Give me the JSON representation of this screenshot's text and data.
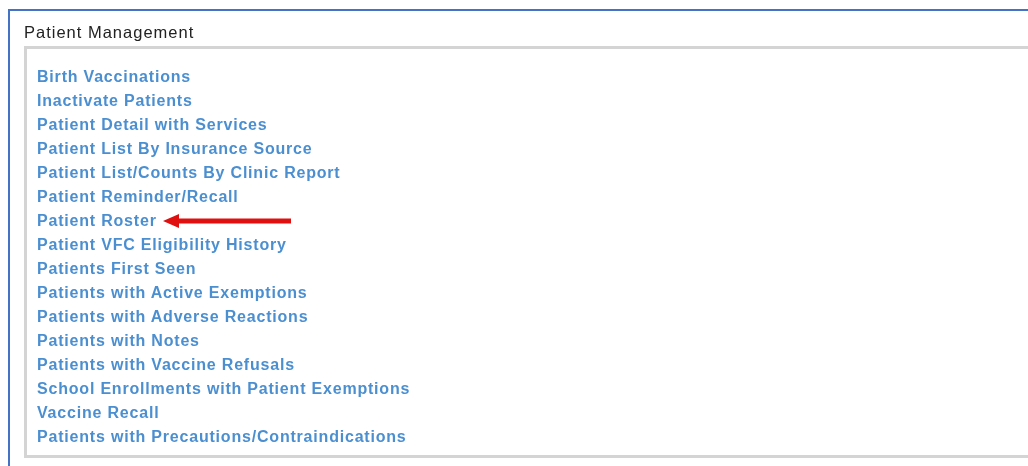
{
  "panel": {
    "title": "Patient Management"
  },
  "links": [
    {
      "label": "Birth Vaccinations",
      "marked": false
    },
    {
      "label": "Inactivate Patients",
      "marked": false
    },
    {
      "label": "Patient Detail with Services",
      "marked": false
    },
    {
      "label": "Patient List By Insurance Source",
      "marked": false
    },
    {
      "label": "Patient List/Counts By Clinic Report",
      "marked": false
    },
    {
      "label": "Patient Reminder/Recall",
      "marked": false
    },
    {
      "label": "Patient Roster",
      "marked": true
    },
    {
      "label": "Patient VFC Eligibility History",
      "marked": false
    },
    {
      "label": "Patients First Seen",
      "marked": false
    },
    {
      "label": "Patients with Active Exemptions",
      "marked": false
    },
    {
      "label": "Patients with Adverse Reactions",
      "marked": false
    },
    {
      "label": "Patients with Notes",
      "marked": false
    },
    {
      "label": "Patients with Vaccine Refusals",
      "marked": false
    },
    {
      "label": "School Enrollments with Patient Exemptions",
      "marked": false
    },
    {
      "label": "Vaccine Recall",
      "marked": false
    },
    {
      "label": "Patients with Precautions/Contraindications",
      "marked": false
    }
  ]
}
